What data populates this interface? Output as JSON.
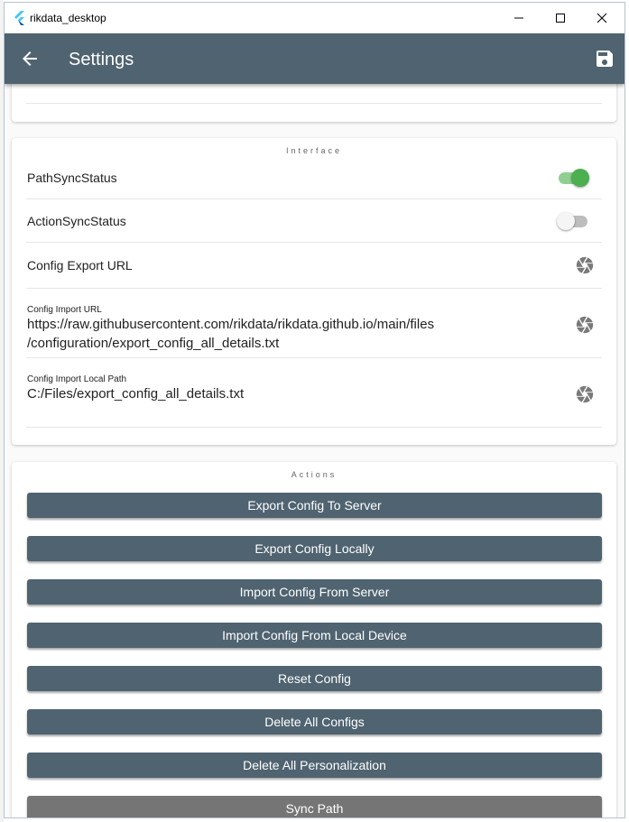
{
  "window": {
    "title": "rikdata_desktop"
  },
  "appbar": {
    "title": "Settings",
    "back_icon": "arrow-left-icon",
    "save_icon": "floppy-disk-icon"
  },
  "interface": {
    "section_title": "Interface",
    "path_sync": {
      "label": "PathSyncStatus",
      "enabled": true
    },
    "action_sync": {
      "label": "ActionSyncStatus",
      "enabled": false
    },
    "config_export_url": {
      "label": "Config Export URL"
    },
    "config_import_url": {
      "label": "Config Import URL",
      "value_line1": "https://raw.githubusercontent.com/rikdata/rikdata.github.io/main/files",
      "value_line2": "/configuration/export_config_all_details.txt"
    },
    "config_import_local_path": {
      "label": "Config Import Local Path",
      "value": "C:/Files/export_config_all_details.txt"
    }
  },
  "actions": {
    "section_title": "Actions",
    "buttons": [
      {
        "label": "Export Config To Server"
      },
      {
        "label": "Export Config Locally"
      },
      {
        "label": "Import Config From Server"
      },
      {
        "label": "Import Config From Local Device"
      },
      {
        "label": "Reset Config"
      },
      {
        "label": "Delete All Configs"
      },
      {
        "label": "Delete All Personalization"
      },
      {
        "label": "Sync Path"
      }
    ]
  },
  "colors": {
    "appbar": "#4f6370",
    "toggle_on": "#4caf50",
    "button_disabled": "#757575"
  }
}
